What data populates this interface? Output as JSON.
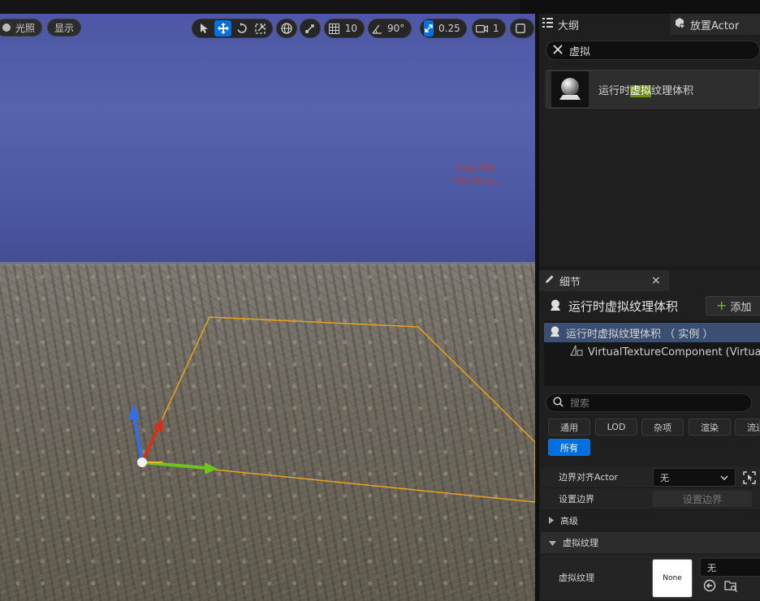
{
  "viewport": {
    "lighting_label": "光照",
    "show_label": "显示",
    "grid_value": "10",
    "angle_value": "90°",
    "scale_value": "0.25",
    "camera_speed": "1",
    "fps": "6.63 FPS",
    "ms": "150.76 ms"
  },
  "outliner": {
    "tab_label": "大纲",
    "place_actor_label": "放置Actor",
    "search_value": "虚拟",
    "result": {
      "prefix": "运行时",
      "highlight": "虚拟",
      "suffix": "纹理体积"
    }
  },
  "details": {
    "tab_label": "细节",
    "close": "×",
    "actor_title": "运行时虚拟纹理体积",
    "add_label": "添加",
    "instance_row": "运行时虚拟纹理体积 （ 实例 ）",
    "component_row": "VirtualTextureComponent (VirtualTex",
    "search_placeholder": "搜索",
    "filters": [
      "通用",
      "LOD",
      "杂项",
      "渲染",
      "流送"
    ],
    "filter_all": "所有",
    "bounds_align_label": "边界对齐Actor",
    "bounds_align_value": "无",
    "set_bounds_label": "设置边界",
    "set_bounds_button": "设置边界",
    "advanced_label": "高级",
    "vt_section_label": "虚拟纹理",
    "vt_prop_label": "虚拟纹理",
    "vt_thumb_text": "None",
    "vt_value": "无"
  },
  "colors": {
    "accent": "#0070e0",
    "highlight": "#6f8f1b",
    "fps_text": "#c23a2c",
    "selection_box": "#e8a21a"
  }
}
